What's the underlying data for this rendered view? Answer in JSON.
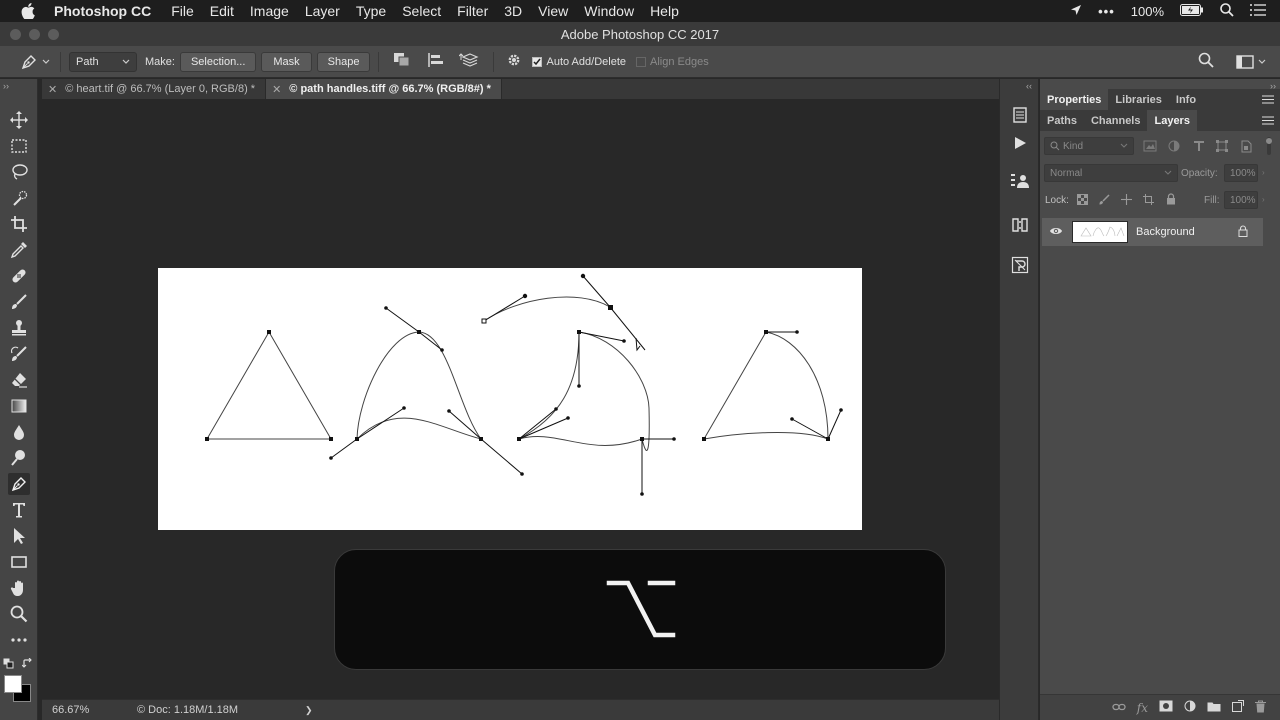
{
  "menubar": {
    "app_name": "Photoshop CC",
    "items": [
      "File",
      "Edit",
      "Image",
      "Layer",
      "Type",
      "Select",
      "Filter",
      "3D",
      "View",
      "Window",
      "Help"
    ],
    "battery": "100%"
  },
  "window": {
    "title": "Adobe Photoshop CC 2017"
  },
  "options": {
    "mode": "Path",
    "make_label": "Make:",
    "selection_btn": "Selection...",
    "mask_btn": "Mask",
    "shape_btn": "Shape",
    "auto_add_delete": "Auto Add/Delete",
    "align_edges": "Align Edges"
  },
  "tabs": [
    {
      "label": "© heart.tif @ 66.7% (Layer 0, RGB/8) *",
      "active": false
    },
    {
      "label": "© path handles.tiff @ 66.7% (RGB/8#) *",
      "active": true
    }
  ],
  "key_overlay": {
    "glyph": "⌥"
  },
  "status": {
    "zoom": "66.67%",
    "doc": "© Doc: 1.18M/1.18M",
    "arrow": "❯"
  },
  "panels": {
    "top_tabs": [
      "Properties",
      "Libraries",
      "Info"
    ],
    "second_tabs": [
      "Paths",
      "Channels",
      "Layers"
    ],
    "kind_placeholder": "Kind",
    "blend_mode": "Normal",
    "opacity_label": "Opacity:",
    "opacity_value": "100%",
    "lock_label": "Lock:",
    "fill_label": "Fill:",
    "fill_value": "100%",
    "layer_name": "Background"
  }
}
